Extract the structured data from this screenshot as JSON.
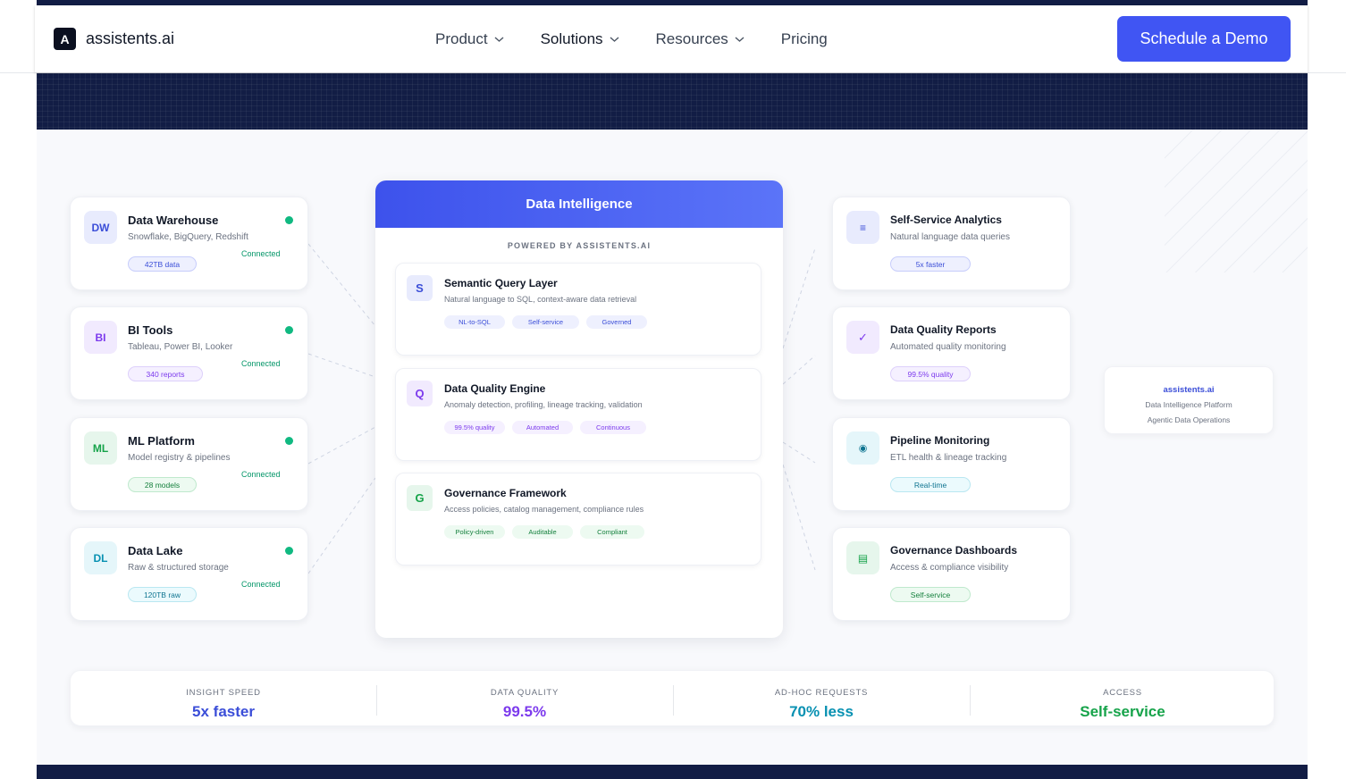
{
  "nav": {
    "logo_mark": "A",
    "logo_text": "assistents.ai",
    "links": [
      {
        "label": "Product",
        "has_dropdown": true
      },
      {
        "label": "Solutions",
        "has_dropdown": true
      },
      {
        "label": "Resources",
        "has_dropdown": true
      },
      {
        "label": "Pricing",
        "has_dropdown": false
      }
    ],
    "cta_label": "Schedule a Demo"
  },
  "colors": {
    "brand": "#4055f3",
    "navy": "#121d45",
    "connected": "#10b981",
    "purple": "#7c3aed",
    "teal": "#0891b2",
    "green": "#16a34a"
  },
  "sources": [
    {
      "badge": "DW",
      "title": "Data Warehouse",
      "subtitle": "Snowflake, BigQuery, Redshift",
      "status": "Connected",
      "metric": "42TB data"
    },
    {
      "badge": "BI",
      "title": "BI Tools",
      "subtitle": "Tableau, Power BI, Looker",
      "status": "Connected",
      "metric": "340 reports"
    },
    {
      "badge": "ML",
      "title": "ML Platform",
      "subtitle": "Model registry & pipelines",
      "status": "Connected",
      "metric": "28 models"
    },
    {
      "badge": "DL",
      "title": "Data Lake",
      "subtitle": "Raw & structured storage",
      "status": "Connected",
      "metric": "120TB raw"
    }
  ],
  "center": {
    "title": "Data Intelligence",
    "powered_by": "POWERED BY ASSISTENTS.AI",
    "layers": [
      {
        "badge": "S",
        "title": "Semantic Query Layer",
        "subtitle": "Natural language to SQL, context-aware data retrieval",
        "tags": [
          "NL-to-SQL",
          "Self-service",
          "Governed"
        ]
      },
      {
        "badge": "Q",
        "title": "Data Quality Engine",
        "subtitle": "Anomaly detection, profiling, lineage tracking, validation",
        "tags": [
          "99.5% quality",
          "Automated",
          "Continuous"
        ]
      },
      {
        "badge": "G",
        "title": "Governance Framework",
        "subtitle": "Access policies, catalog management, compliance rules",
        "tags": [
          "Policy-driven",
          "Auditable",
          "Compliant"
        ]
      }
    ]
  },
  "outputs": [
    {
      "icon": "≡",
      "icon_name": "list-icon",
      "title": "Self-Service Analytics",
      "subtitle": "Natural language data queries",
      "metric": "5x faster"
    },
    {
      "icon": "✓",
      "icon_name": "check-icon",
      "title": "Data Quality Reports",
      "subtitle": "Automated quality monitoring",
      "metric": "99.5% quality"
    },
    {
      "icon": "◉",
      "icon_name": "monitor-icon",
      "title": "Pipeline Monitoring",
      "subtitle": "ETL health & lineage tracking",
      "metric": "Real-time"
    },
    {
      "icon": "▤",
      "icon_name": "dashboard-icon",
      "title": "Governance Dashboards",
      "subtitle": "Access & compliance visibility",
      "metric": "Self-service"
    }
  ],
  "side_card": {
    "name": "assistents.ai",
    "line1": "Data Intelligence Platform",
    "line2": "Agentic Data Operations"
  },
  "stats": [
    {
      "label": "INSIGHT SPEED",
      "value": "5x faster"
    },
    {
      "label": "DATA QUALITY",
      "value": "99.5%"
    },
    {
      "label": "AD-HOC REQUESTS",
      "value": "70% less"
    },
    {
      "label": "ACCESS",
      "value": "Self-service"
    }
  ]
}
